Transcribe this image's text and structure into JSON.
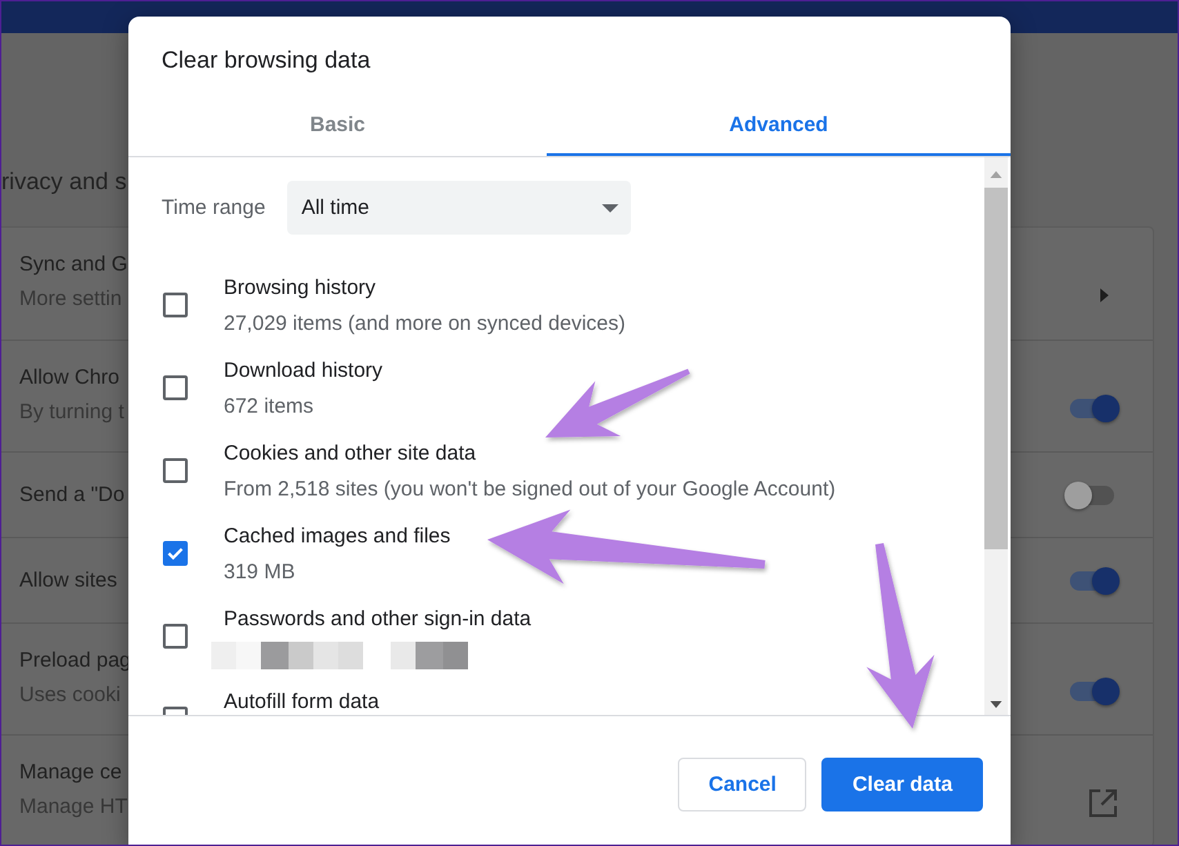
{
  "background_page": {
    "section_title": "rivacy and s",
    "rows": [
      {
        "title": "Sync and G",
        "subtitle": "More settin",
        "kind": "arrow"
      },
      {
        "title": "Allow Chro",
        "subtitle": "By turning t",
        "kind": "toggle",
        "on": true
      },
      {
        "title": "Send a \"Do",
        "kind": "toggle",
        "on": false
      },
      {
        "title": "Allow sites",
        "kind": "toggle",
        "on": true
      },
      {
        "title": "Preload pag",
        "subtitle": "Uses cooki",
        "kind": "toggle",
        "on": true
      },
      {
        "title": "Manage ce",
        "subtitle": "Manage HT",
        "kind": "external"
      }
    ]
  },
  "dialog": {
    "title": "Clear browsing data",
    "tabs": [
      {
        "label": "Basic",
        "selected": false
      },
      {
        "label": "Advanced",
        "selected": true
      }
    ],
    "time_range": {
      "label": "Time range",
      "value": "All time"
    },
    "items": [
      {
        "label": "Browsing history",
        "detail": "27,029 items (and more on synced devices)",
        "checked": false
      },
      {
        "label": "Download history",
        "detail": "672 items",
        "checked": false
      },
      {
        "label": "Cookies and other site data",
        "detail": "From 2,518 sites (you won't be signed out of your Google Account)",
        "checked": false
      },
      {
        "label": "Cached images and files",
        "detail": "319 MB",
        "checked": true
      },
      {
        "label": "Passwords and other sign-in data",
        "detail_redacted": true,
        "checked": false
      },
      {
        "label": "Autofill form data",
        "checked": false
      }
    ],
    "buttons": [
      {
        "label": "Cancel",
        "kind": "secondary"
      },
      {
        "label": "Clear data",
        "kind": "primary"
      }
    ]
  },
  "annotations": [
    {
      "kind": "arrow"
    },
    {
      "kind": "arrow"
    },
    {
      "kind": "arrow"
    }
  ]
}
